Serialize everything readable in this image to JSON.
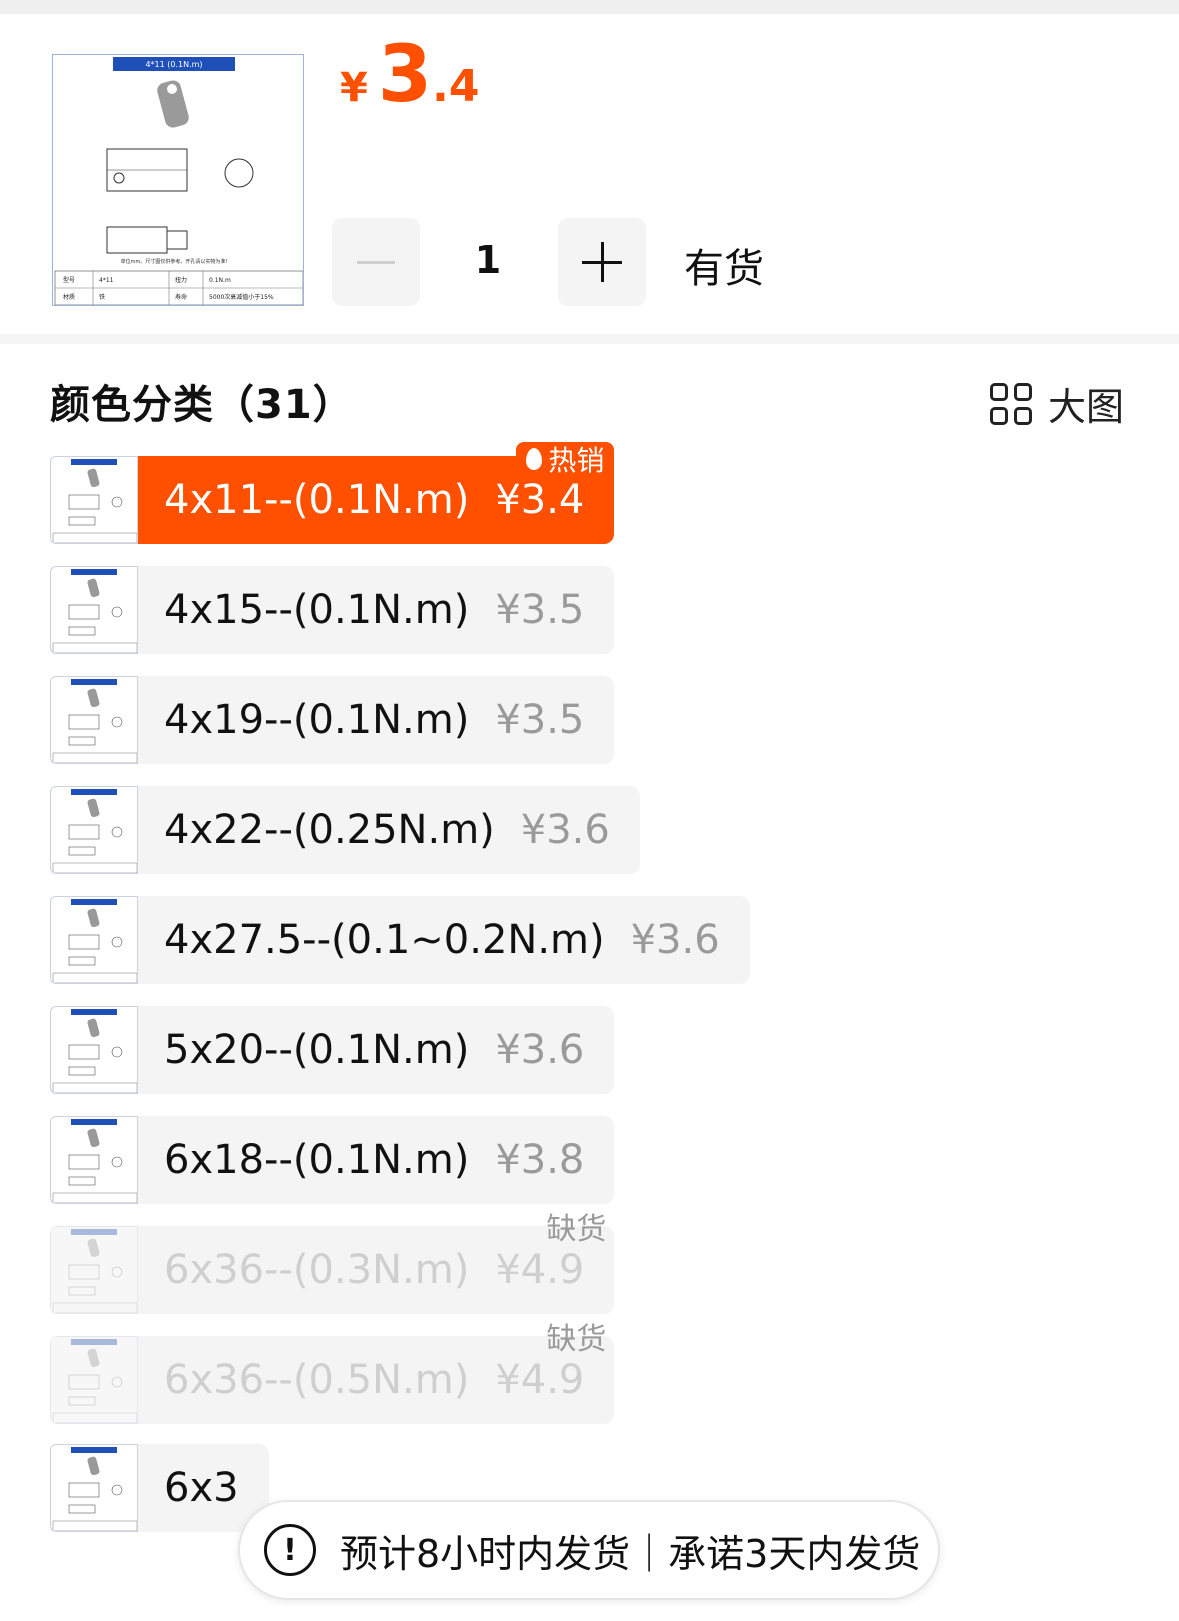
{
  "product": {
    "thumb_header": "4*11 (0.1N.m)",
    "thumb_note": "单位mm。尺寸图仅供参考。开孔请以实物为准!",
    "thumb_table": [
      [
        "型号",
        "4*11",
        "扭力",
        "0.1N.m"
      ],
      [
        "材质",
        "铁",
        "寿命",
        "5000次衰减值小于15%"
      ]
    ]
  },
  "price": {
    "currency": "¥",
    "integer": "3",
    "decimal": ".4"
  },
  "quantity": {
    "value": "1"
  },
  "stock_status": "有货",
  "category": {
    "title": "颜色分类（31）",
    "big_view_label": "大图"
  },
  "options": [
    {
      "label": "4x11--(0.1N.m)",
      "price": "¥3.4",
      "state": "selected",
      "tag": "热销"
    },
    {
      "label": "4x15--(0.1N.m)",
      "price": "¥3.5",
      "state": "normal",
      "tag": ""
    },
    {
      "label": "4x19--(0.1N.m)",
      "price": "¥3.5",
      "state": "normal",
      "tag": ""
    },
    {
      "label": "4x22--(0.25N.m)",
      "price": "¥3.6",
      "state": "normal",
      "tag": ""
    },
    {
      "label": "4x27.5--(0.1~0.2N.m)",
      "price": "¥3.6",
      "state": "normal",
      "tag": ""
    },
    {
      "label": "5x20--(0.1N.m)",
      "price": "¥3.6",
      "state": "normal",
      "tag": ""
    },
    {
      "label": "6x18--(0.1N.m)",
      "price": "¥3.8",
      "state": "normal",
      "tag": ""
    },
    {
      "label": "6x36--(0.3N.m)",
      "price": "¥4.9",
      "state": "disabled",
      "tag": "缺货"
    },
    {
      "label": "6x36--(0.5N.m)",
      "price": "¥4.9",
      "state": "disabled",
      "tag": "缺货"
    },
    {
      "label": "6x3",
      "price": "",
      "state": "normal",
      "tag": ""
    }
  ],
  "shipping_notice": "预计8小时内发货｜承诺3天内发货",
  "colors": {
    "accent": "#ff5000",
    "muted": "#9a9a9a",
    "chip_bg": "#f4f4f4"
  }
}
